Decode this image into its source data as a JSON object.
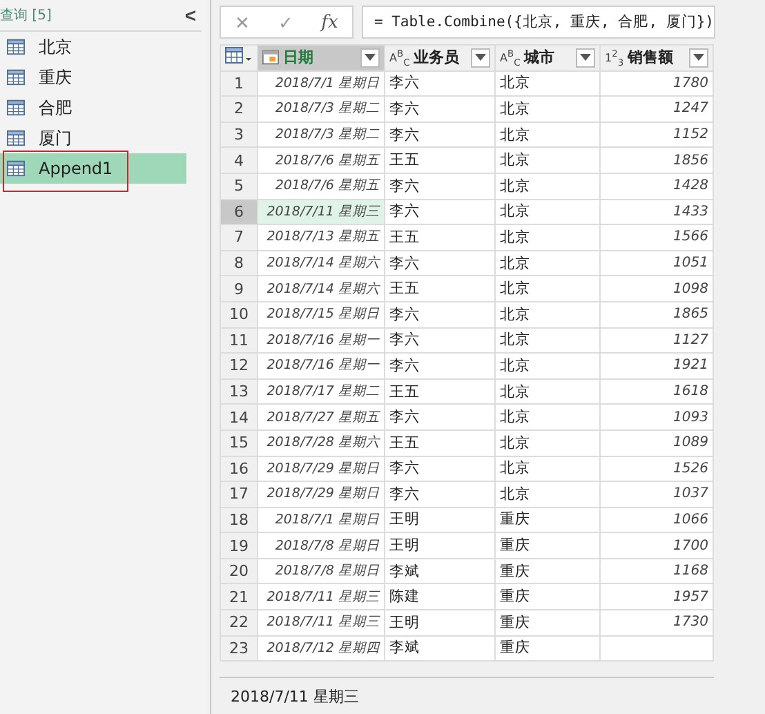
{
  "queries": {
    "title": "查询 [5]",
    "collapse": "<",
    "items": [
      {
        "label": "北京",
        "selected": false,
        "highlighted": false
      },
      {
        "label": "重庆",
        "selected": false,
        "highlighted": false
      },
      {
        "label": "合肥",
        "selected": false,
        "highlighted": false
      },
      {
        "label": "厦门",
        "selected": false,
        "highlighted": false
      },
      {
        "label": "Append1",
        "selected": true,
        "highlighted": true
      }
    ]
  },
  "formula_bar": {
    "cancel": "✕",
    "confirm": "✓",
    "fx": "fx",
    "formula": "= Table.Combine({北京, 重庆, 合肥, 厦门})"
  },
  "table": {
    "columns": [
      {
        "label": "日期",
        "kind": "date",
        "selected": true
      },
      {
        "label": "业务员",
        "kind": "text",
        "type_glyph": "A$^{B}$$_{C}$",
        "selected": false
      },
      {
        "label": "城市",
        "kind": "text",
        "type_glyph": "A$^{B}$$_{C}$",
        "selected": false
      },
      {
        "label": "销售额",
        "kind": "number",
        "type_glyph": "1$^{2}$$_{3}$",
        "selected": false
      }
    ],
    "rows": [
      {
        "n": "1",
        "cells": [
          "2018/7/1 星期日",
          "李六",
          "北京",
          "1780"
        ],
        "selected": false
      },
      {
        "n": "2",
        "cells": [
          "2018/7/3 星期二",
          "李六",
          "北京",
          "1247"
        ],
        "selected": false
      },
      {
        "n": "3",
        "cells": [
          "2018/7/3 星期二",
          "李六",
          "北京",
          "1152"
        ],
        "selected": false
      },
      {
        "n": "4",
        "cells": [
          "2018/7/6 星期五",
          "王五",
          "北京",
          "1856"
        ],
        "selected": false
      },
      {
        "n": "5",
        "cells": [
          "2018/7/6 星期五",
          "李六",
          "北京",
          "1428"
        ],
        "selected": false
      },
      {
        "n": "6",
        "cells": [
          "2018/7/11 星期三",
          "李六",
          "北京",
          "1433"
        ],
        "selected": true
      },
      {
        "n": "7",
        "cells": [
          "2018/7/13 星期五",
          "王五",
          "北京",
          "1566"
        ],
        "selected": false
      },
      {
        "n": "8",
        "cells": [
          "2018/7/14 星期六",
          "李六",
          "北京",
          "1051"
        ],
        "selected": false
      },
      {
        "n": "9",
        "cells": [
          "2018/7/14 星期六",
          "王五",
          "北京",
          "1098"
        ],
        "selected": false
      },
      {
        "n": "10",
        "cells": [
          "2018/7/15 星期日",
          "李六",
          "北京",
          "1865"
        ],
        "selected": false
      },
      {
        "n": "11",
        "cells": [
          "2018/7/16 星期一",
          "李六",
          "北京",
          "1127"
        ],
        "selected": false
      },
      {
        "n": "12",
        "cells": [
          "2018/7/16 星期一",
          "李六",
          "北京",
          "1921"
        ],
        "selected": false
      },
      {
        "n": "13",
        "cells": [
          "2018/7/17 星期二",
          "王五",
          "北京",
          "1618"
        ],
        "selected": false
      },
      {
        "n": "14",
        "cells": [
          "2018/7/27 星期五",
          "李六",
          "北京",
          "1093"
        ],
        "selected": false
      },
      {
        "n": "15",
        "cells": [
          "2018/7/28 星期六",
          "王五",
          "北京",
          "1089"
        ],
        "selected": false
      },
      {
        "n": "16",
        "cells": [
          "2018/7/29 星期日",
          "李六",
          "北京",
          "1526"
        ],
        "selected": false
      },
      {
        "n": "17",
        "cells": [
          "2018/7/29 星期日",
          "李六",
          "北京",
          "1037"
        ],
        "selected": false
      },
      {
        "n": "18",
        "cells": [
          "2018/7/1 星期日",
          "王明",
          "重庆",
          "1066"
        ],
        "selected": false
      },
      {
        "n": "19",
        "cells": [
          "2018/7/8 星期日",
          "王明",
          "重庆",
          "1700"
        ],
        "selected": false
      },
      {
        "n": "20",
        "cells": [
          "2018/7/8 星期日",
          "李斌",
          "重庆",
          "1168"
        ],
        "selected": false
      },
      {
        "n": "21",
        "cells": [
          "2018/7/11 星期三",
          "陈建",
          "重庆",
          "1957"
        ],
        "selected": false
      },
      {
        "n": "22",
        "cells": [
          "2018/7/11 星期三",
          "王明",
          "重庆",
          "1730"
        ],
        "selected": false
      },
      {
        "n": "23",
        "cells": [
          "2018/7/12 星期四",
          "李斌",
          "重庆"
        ],
        "selected": false
      }
    ]
  },
  "status_bar": {
    "value": "2018/7/11 星期三"
  }
}
